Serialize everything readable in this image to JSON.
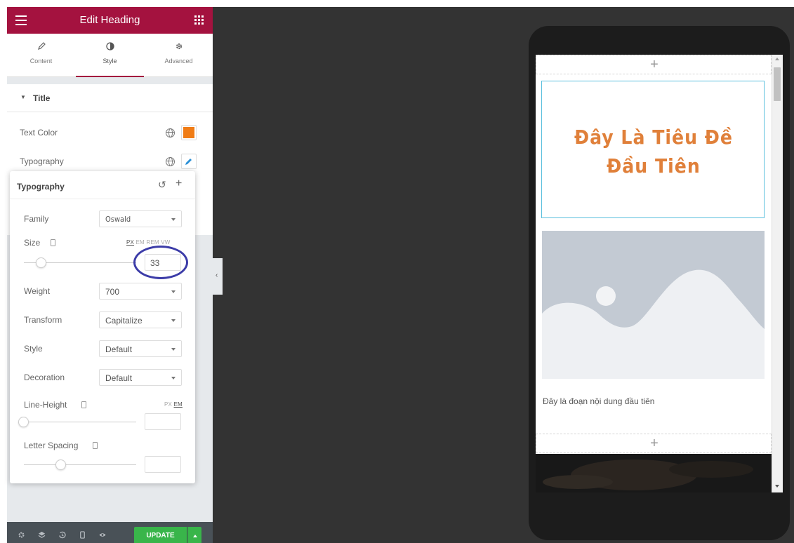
{
  "panel": {
    "header_title": "Edit Heading",
    "tabs": [
      {
        "label": "Content",
        "icon": "pencil-icon"
      },
      {
        "label": "Style",
        "icon": "half-circle-icon",
        "active": true
      },
      {
        "label": "Advanced",
        "icon": "gear-icon"
      }
    ],
    "section_title": "Title",
    "text_color_label": "Text Color",
    "text_color_value": "#f07c16",
    "typography_label": "Typography"
  },
  "typography_popover": {
    "title": "Typography",
    "family_label": "Family",
    "family_value": "Oswald",
    "size_label": "Size",
    "size_units": [
      "PX",
      "EM",
      "REM",
      "VW"
    ],
    "size_value": "33",
    "weight_label": "Weight",
    "weight_value": "700",
    "transform_label": "Transform",
    "transform_value": "Capitalize",
    "style_label": "Style",
    "style_value": "Default",
    "decoration_label": "Decoration",
    "decoration_value": "Default",
    "line_height_label": "Line-Height",
    "line_height_units": [
      "PX",
      "EM"
    ],
    "line_height_value": "",
    "letter_spacing_label": "Letter Spacing",
    "letter_spacing_value": ""
  },
  "footer": {
    "update_label": "UPDATE",
    "icons": [
      "gear-icon",
      "layers-icon",
      "history-icon",
      "responsive-icon",
      "eye-icon"
    ]
  },
  "preview": {
    "heading_line1": "Đây Là Tiêu Đề",
    "heading_line2": "Đầu Tiên",
    "heading_color": "#e0803a",
    "paragraph": "Đây là đoạn nội dung đầu tiên",
    "add_symbol": "+"
  }
}
